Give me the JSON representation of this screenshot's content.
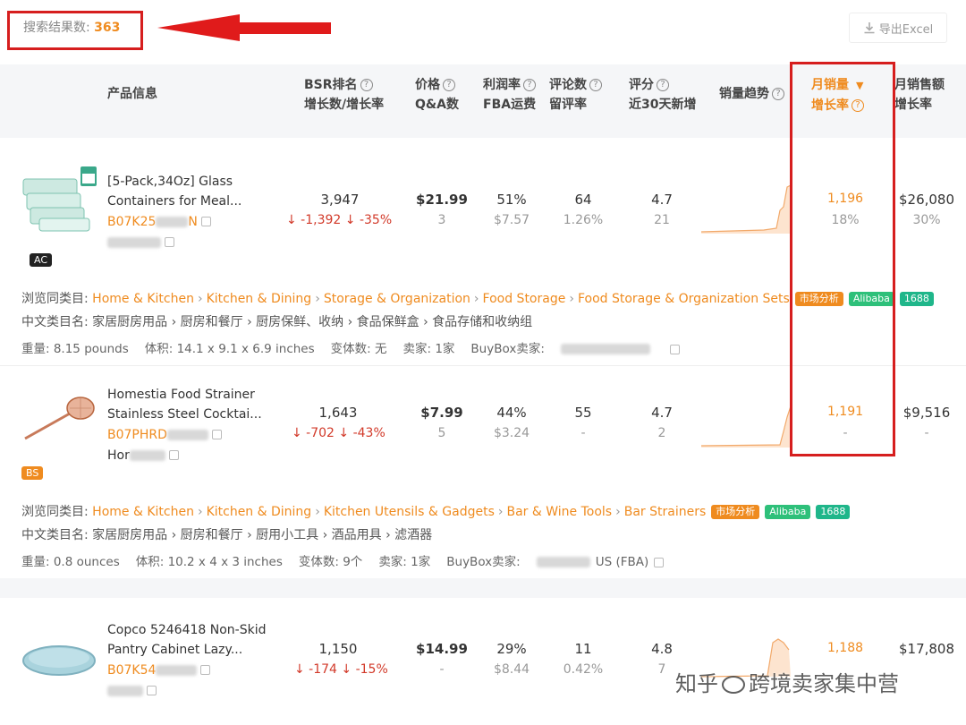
{
  "results": {
    "label": "搜索结果数:",
    "count": "363"
  },
  "export": {
    "label": "导出Excel"
  },
  "headers": {
    "product": "产品信息",
    "bsr_line1": "BSR排名",
    "bsr_line2": "增长数/增长率",
    "price_line1": "价格",
    "price_line2": "Q&A数",
    "profit_line1": "利润率",
    "profit_line2": "FBA运费",
    "reviews_line1": "评论数",
    "reviews_line2": "留评率",
    "rating_line1": "评分",
    "rating_line2": "近30天新增",
    "trend": "销量趋势",
    "sales_line1": "月销量",
    "sales_line2": "增长率",
    "revenue_line1": "月销售额",
    "revenue_line2": "增长率"
  },
  "products": [
    {
      "title_line1": "[5-Pack,34Oz] Glass",
      "title_line2": "Containers for Meal...",
      "asin": "B07K25",
      "asin_tail": "N",
      "badge": "AC",
      "bsr": "3,947",
      "bsr_change": "↓ -1,392",
      "bsr_rate": "↓ -35%",
      "price": "$21.99",
      "qa": "3",
      "profit": "51%",
      "fba": "$7.57",
      "reviews": "64",
      "review_rate": "1.26%",
      "rating": "4.7",
      "new30": "21",
      "sales": "1,196",
      "sales_growth": "18%",
      "revenue": "$26,080",
      "revenue_growth": "30%",
      "category_label": "浏览同类目:",
      "categories": [
        "Home & Kitchen",
        "Kitchen & Dining",
        "Storage & Organization",
        "Food Storage",
        "Food Storage & Organization Sets"
      ],
      "cn_label": "中文类目名:",
      "cn_categories": "家居厨房用品 › 厨房和餐厅 › 厨房保鲜、收纳 › 食品保鲜盒 › 食品存储和收纳组",
      "weight": "重量: 8.15 pounds",
      "volume": "体积: 14.1 x 9.1 x 6.9 inches",
      "variants": "变体数: 无",
      "sellers": "卖家: 1家",
      "buybox": "BuyBox卖家:",
      "buybox_value": ""
    },
    {
      "title_line1": "Homestia Food Strainer",
      "title_line2": "Stainless Steel Cocktai...",
      "asin": "B07PHRD",
      "asin_tail": "",
      "brand": "Hor",
      "badge": "BS",
      "bsr": "1,643",
      "bsr_change": "↓ -702",
      "bsr_rate": "↓ -43%",
      "price": "$7.99",
      "qa": "5",
      "profit": "44%",
      "fba": "$3.24",
      "reviews": "55",
      "review_rate": "-",
      "rating": "4.7",
      "new30": "2",
      "sales": "1,191",
      "sales_growth": "-",
      "revenue": "$9,516",
      "revenue_growth": "-",
      "category_label": "浏览同类目:",
      "categories": [
        "Home & Kitchen",
        "Kitchen & Dining",
        "Kitchen Utensils & Gadgets",
        "Bar & Wine Tools",
        "Bar Strainers"
      ],
      "cn_label": "中文类目名:",
      "cn_categories": "家居厨房用品 › 厨房和餐厅 › 厨用小工具 › 酒品用具 › 滤酒器",
      "weight": "重量: 0.8 ounces",
      "volume": "体积: 10.2 x 4 x 3 inches",
      "variants": "变体数: 9个",
      "sellers": "卖家: 1家",
      "buybox": "BuyBox卖家:",
      "buybox_value": "US (FBA)"
    },
    {
      "title_line1": "Copco 5246418 Non-Skid",
      "title_line2": "Pantry Cabinet Lazy...",
      "asin": "B07K54",
      "asin_tail": "",
      "bsr": "1,150",
      "bsr_change": "↓ -174",
      "bsr_rate": "↓ -15%",
      "price": "$14.99",
      "qa": "-",
      "profit": "29%",
      "fba": "$8.44",
      "reviews": "11",
      "review_rate": "0.42%",
      "rating": "4.8",
      "new30": "7",
      "sales": "1,188",
      "sales_growth": "",
      "revenue": "$17,808",
      "revenue_growth": ""
    }
  ],
  "tags": {
    "market": "市场分析",
    "alibaba": "Alibaba",
    "code": "1688"
  },
  "watermark": "知乎 @跨境卖家集中营",
  "watermark_site": "知乎",
  "watermark_account": "跨境卖家集中营",
  "colors": {
    "accent": "#ef8b1f",
    "alert": "#d61e1e",
    "negative": "#d23a2a",
    "header_bg": "#f5f6f8"
  }
}
